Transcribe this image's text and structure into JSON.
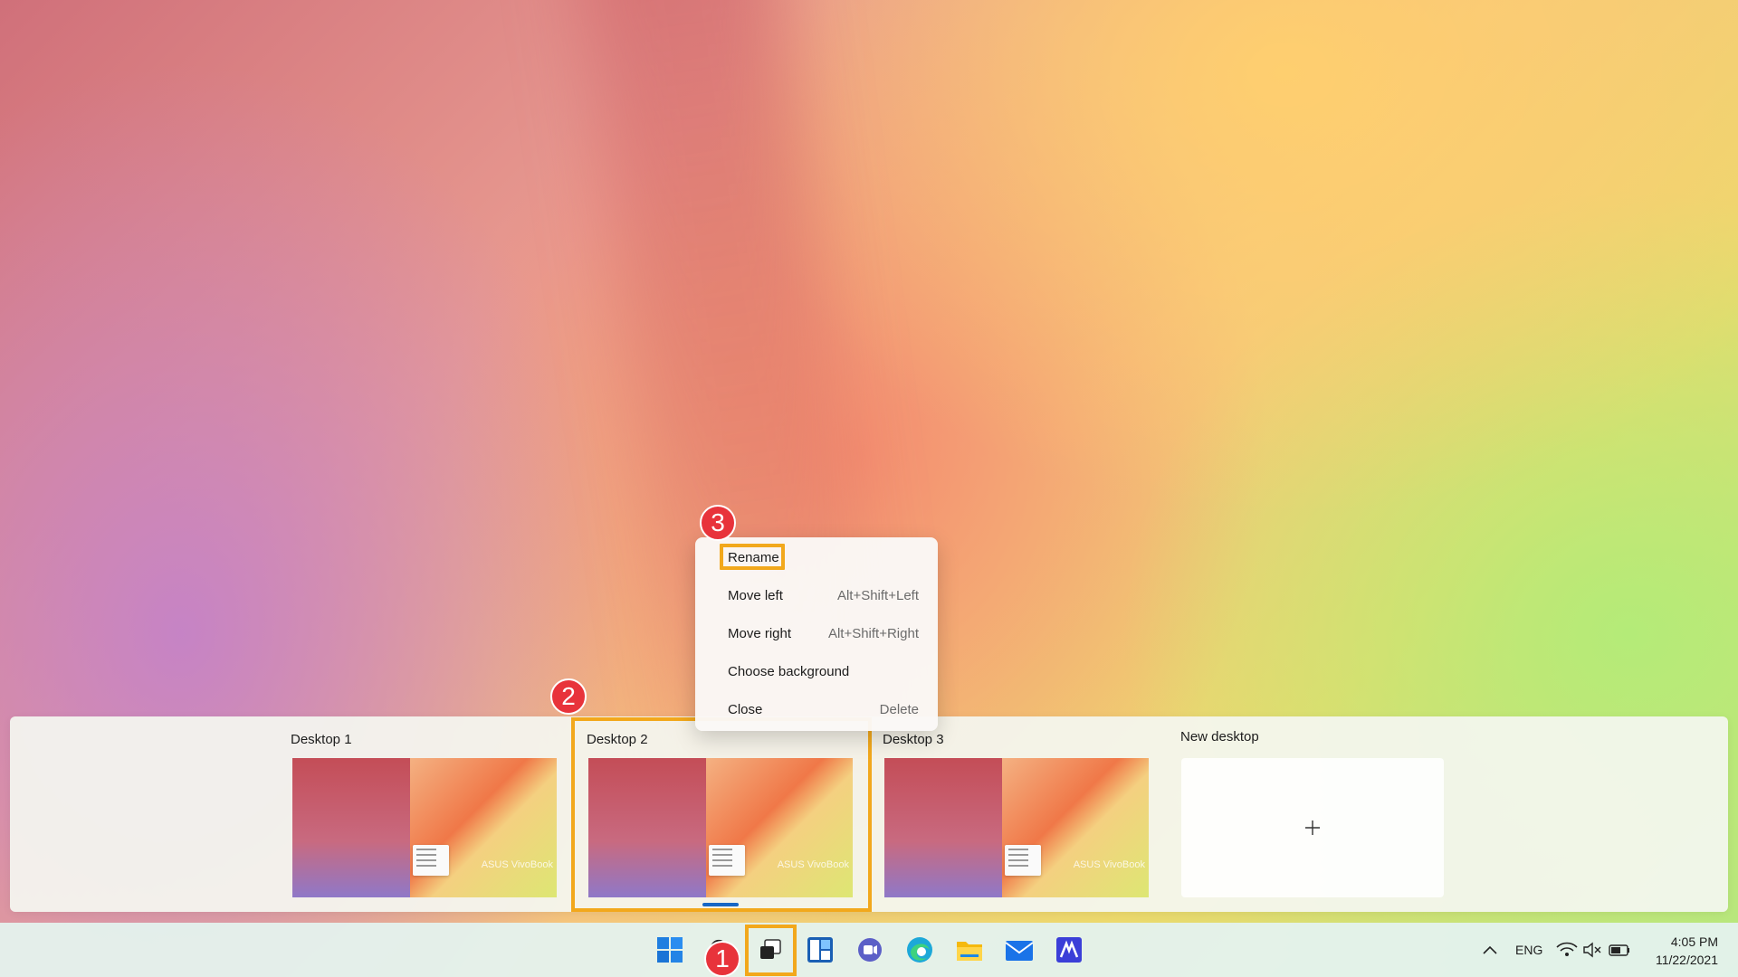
{
  "context_menu": {
    "items": [
      {
        "label": "Rename",
        "shortcut": ""
      },
      {
        "label": "Move left",
        "shortcut": "Alt+Shift+Left"
      },
      {
        "label": "Move right",
        "shortcut": "Alt+Shift+Right"
      },
      {
        "label": "Choose background",
        "shortcut": ""
      },
      {
        "label": "Close",
        "shortcut": "Delete"
      }
    ]
  },
  "desktops": [
    {
      "label": "Desktop 1",
      "brand": "ASUS VivoBook"
    },
    {
      "label": "Desktop 2",
      "brand": "ASUS VivoBook"
    },
    {
      "label": "Desktop 3",
      "brand": "ASUS VivoBook"
    }
  ],
  "new_desktop": {
    "label": "New desktop"
  },
  "badges": [
    "1",
    "2",
    "3"
  ],
  "tray": {
    "language": "ENG",
    "time": "4:05 PM",
    "date": "11/22/2021"
  },
  "colors": {
    "highlight": "#f2a81c",
    "badge": "#e8333b",
    "accent": "#1767c5"
  }
}
